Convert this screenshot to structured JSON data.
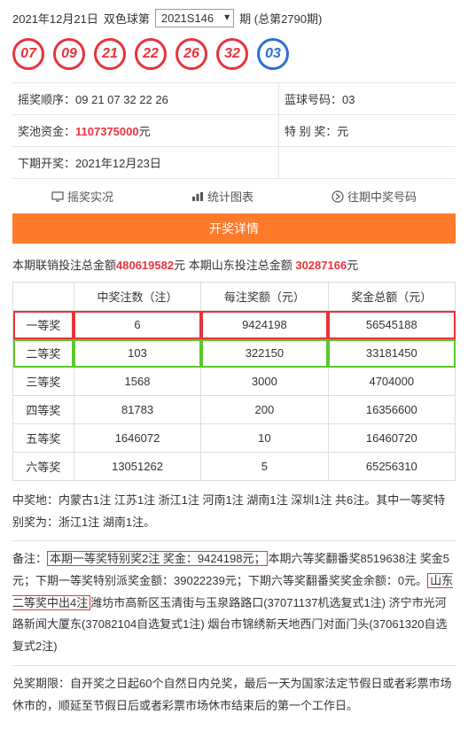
{
  "header": {
    "date": "2021年12月21日",
    "game": "双色球第",
    "period": "2021S146",
    "suffix": "期 (总第2790期)"
  },
  "balls": {
    "red": [
      "07",
      "09",
      "21",
      "22",
      "26",
      "32"
    ],
    "blue": "03"
  },
  "info": {
    "r1c1_label": "摇奖顺序：",
    "r1c1_value": "09 21 07 32 22 26",
    "r1c2_label": "蓝球号码：",
    "r1c2_value": "03",
    "r2c1_label": "奖池资金：",
    "r2c1_value": "1107375000",
    "r2c1_unit": "元",
    "r2c2": "特 别 奖：元",
    "r3c1_label": "下期开奖：",
    "r3c1_value": "2021年12月23日"
  },
  "nav": {
    "live": "摇奖实况",
    "stats": "统计图表",
    "history": "往期中奖号码"
  },
  "button": "开奖详情",
  "summary": {
    "t1": "本期联销投注总金额",
    "v1": "480619582",
    "u1": "元 ",
    "t2": "本期山东投注总金额 ",
    "v2": "30287166",
    "u2": "元"
  },
  "table": {
    "headers": [
      "",
      "中奖注数（注）",
      "每注奖额（元）",
      "奖金总额（元）"
    ],
    "rows": [
      {
        "label": "一等奖",
        "count": "6",
        "per": "9424198",
        "total": "56545188",
        "hl": "red"
      },
      {
        "label": "二等奖",
        "count": "103",
        "per": "322150",
        "total": "33181450",
        "hl": "green"
      },
      {
        "label": "三等奖",
        "count": "1568",
        "per": "3000",
        "total": "4704000"
      },
      {
        "label": "四等奖",
        "count": "81783",
        "per": "200",
        "total": "16356600"
      },
      {
        "label": "五等奖",
        "count": "1646072",
        "per": "10",
        "total": "16460720"
      },
      {
        "label": "六等奖",
        "count": "13051262",
        "per": "5",
        "total": "65256310"
      }
    ]
  },
  "notes": {
    "p1": "中奖地：内蒙古1注 江苏1注 浙江1注 河南1注 湖南1注 深圳1注 共6注。其中一等奖特别奖为：浙江1注 湖南1注。",
    "p2a": "备注：",
    "p2b": "本期一等奖特别奖2注 奖金：9424198元；",
    "p2c": "本期六等奖翻番奖8519638注 奖金5元；下期一等奖特别派奖金额：39022239元；下期六等奖翻番奖奖金余额：0元。",
    "p2d": "山东二等奖中出4注",
    "p2e": "潍坊市高新区玉清街与玉泉路路口(37071137机选复式1注) 济宁市光河路新闻大厦东(37082104自选复式1注) 烟台市锦绣新天地西门对面门头(37061320自选复式2注)",
    "p3": "兑奖期限：自开奖之日起60个自然日内兑奖，最后一天为国家法定节假日或者彩票市场休市的，顺延至节假日后或者彩票市场休市结束后的第一个工作日。"
  }
}
